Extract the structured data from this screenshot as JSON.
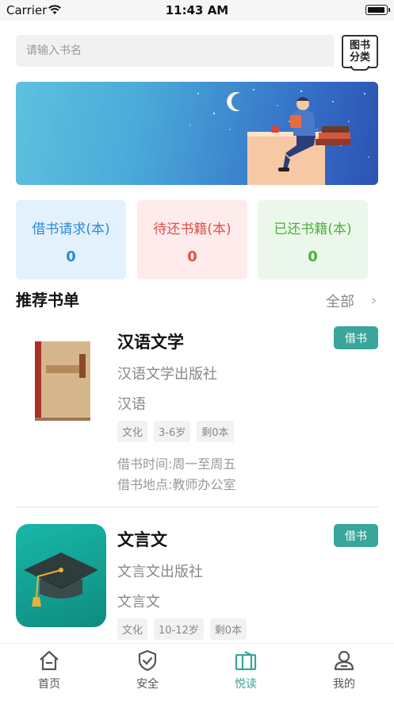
{
  "status_bar": {
    "carrier": "Carrier",
    "time": "11:43 AM"
  },
  "search": {
    "placeholder": "请输入书名"
  },
  "category_button": {
    "line1": "图书",
    "line2": "分类"
  },
  "stats": [
    {
      "label": "借书请求(本)",
      "value": "0",
      "color": "#2a8ad7"
    },
    {
      "label": "待还书籍(本)",
      "value": "0",
      "color": "#e24e4b"
    },
    {
      "label": "已还书籍(本)",
      "value": "0",
      "color": "#4caf3e"
    }
  ],
  "recommend": {
    "title": "推荐书单",
    "all_label": "全部"
  },
  "books": [
    {
      "title": "汉语文学",
      "publisher": "汉语文学出版社",
      "language": "汉语",
      "tags": [
        "文化",
        "3-6岁",
        "剩0本"
      ],
      "time": "借书时间:周一至周五",
      "location": "借书地点:教师办公室",
      "button": "借书"
    },
    {
      "title": "文言文",
      "publisher": "文言文出版社",
      "language": "文言文",
      "tags": [
        "文化",
        "10-12岁",
        "剩0本"
      ],
      "button": "借书"
    }
  ],
  "tabs": [
    {
      "label": "首页",
      "icon": "home-icon"
    },
    {
      "label": "安全",
      "icon": "shield-icon"
    },
    {
      "label": "悦读",
      "icon": "book-icon",
      "active": true
    },
    {
      "label": "我的",
      "icon": "user-icon"
    }
  ],
  "colors": {
    "accent": "#39a59b"
  }
}
